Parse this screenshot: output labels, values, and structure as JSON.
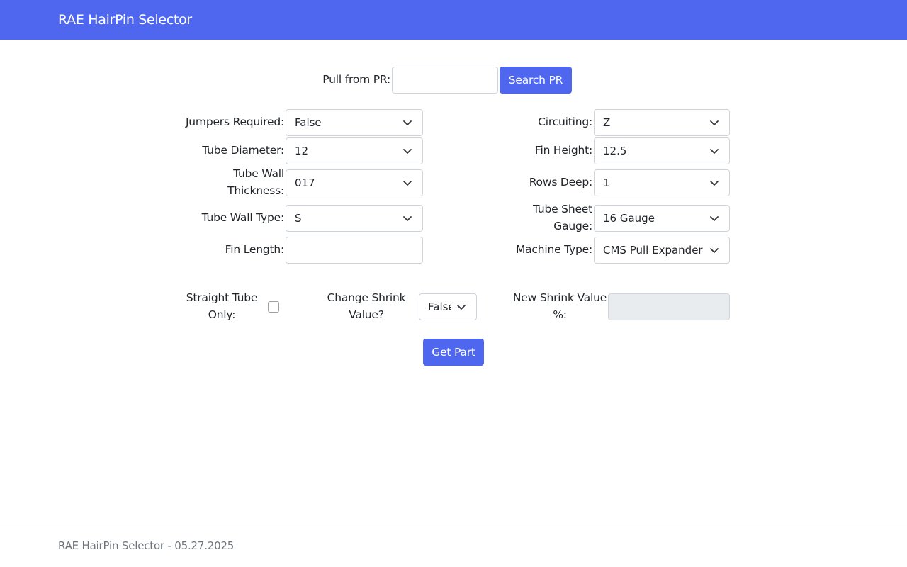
{
  "navbar": {
    "brand": "RAE HairPin Selector"
  },
  "pr_search": {
    "label": "Pull from PR:",
    "input_value": "",
    "button_label": "Search PR"
  },
  "left_fields": {
    "jumpers_required": {
      "label": "Jumpers Required:",
      "value": "False"
    },
    "tube_diameter": {
      "label": "Tube Diameter:",
      "value": "12"
    },
    "tube_wall_thickness": {
      "label_line1": "Tube Wall",
      "label_line2": "Thickness:",
      "value": "017"
    },
    "tube_wall_type": {
      "label": "Tube Wall Type:",
      "value": "S"
    },
    "fin_length": {
      "label": "Fin Length:",
      "value": ""
    }
  },
  "right_fields": {
    "circuiting": {
      "label": "Circuiting:",
      "value": "Z"
    },
    "fin_height": {
      "label": "Fin Height:",
      "value": "12.5"
    },
    "rows_deep": {
      "label": "Rows Deep:",
      "value": "1"
    },
    "tube_sheet_gauge": {
      "label_line1": "Tube Sheet",
      "label_line2": "Gauge:",
      "value": "16 Gauge"
    },
    "machine_type": {
      "label": "Machine Type:",
      "value": "CMS Pull Expander"
    }
  },
  "options": {
    "straight_tube_only": {
      "label_line1": "Straight Tube",
      "label_line2": "Only:",
      "checked": false
    },
    "change_shrink": {
      "label_line1": "Change Shrink",
      "label_line2": "Value?",
      "value": "False"
    },
    "new_shrink": {
      "label_line1": "New Shrink Value",
      "label_line2": "%:",
      "value": ""
    }
  },
  "actions": {
    "get_part_label": "Get Part"
  },
  "footer": {
    "text": "RAE HairPin Selector - 05.27.2025"
  },
  "colors": {
    "primary": "#4f67ef",
    "disabled_bg": "#e9ecef",
    "border": "#ced4da",
    "footer_text": "#6c757d"
  },
  "icons": {
    "select_caret": "chevron-down-icon"
  }
}
